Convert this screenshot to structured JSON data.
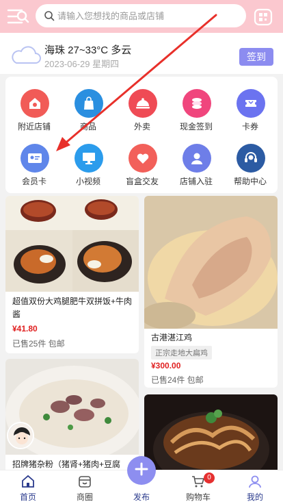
{
  "search": {
    "placeholder": "请输入您想找的商品或店铺"
  },
  "weather": {
    "summary": "海珠 27~33°C 多云",
    "date": "2023-06-29 星期四",
    "signin_label": "签到"
  },
  "grid": [
    {
      "label": "附近店铺",
      "icon": "shop-icon",
      "color": "#f15b57"
    },
    {
      "label": "商品",
      "icon": "bag-icon",
      "color": "#2a8fe0"
    },
    {
      "label": "外卖",
      "icon": "dish-cover-icon",
      "color": "#ef4b55"
    },
    {
      "label": "现金签到",
      "icon": "coins-icon",
      "color": "#f0467d"
    },
    {
      "label": "卡券",
      "icon": "ticket-icon",
      "color": "#6b73f0"
    },
    {
      "label": "会员卡",
      "icon": "member-card-icon",
      "color": "#5f86ea"
    },
    {
      "label": "小视频",
      "icon": "monitor-icon",
      "color": "#2b9cec"
    },
    {
      "label": "盲盒交友",
      "icon": "heart-icon",
      "color": "#f2605a"
    },
    {
      "label": "店铺入驻",
      "icon": "person-icon",
      "color": "#6e7ee8"
    },
    {
      "label": "帮助中心",
      "icon": "headset-icon",
      "color": "#2c5ba3"
    }
  ],
  "products": [
    {
      "title": "超值双份大鸡腿肥牛双拼饭+牛肉酱",
      "price": "¥41.80",
      "sold": "已售25件 包邮"
    },
    {
      "title": "古港湛江鸡",
      "tag": "正宗走地大扁鸡",
      "price": "¥300.00",
      "sold": "已售24件 包邮"
    },
    {
      "title": "招牌猪杂粉（猪肾+猪肉+豆腐"
    }
  ],
  "tabs": [
    {
      "label": "首页",
      "icon": "home-icon"
    },
    {
      "label": "商圈",
      "icon": "store-icon"
    },
    {
      "label": "发布",
      "icon": "plus-icon"
    },
    {
      "label": "购物车",
      "icon": "cart-icon"
    },
    {
      "label": "我的",
      "icon": "user-icon"
    }
  ],
  "cart_badge": "0",
  "colors": {
    "header": "#fbc8cf",
    "accent": "#8c8cf0",
    "price": "#e02020"
  }
}
